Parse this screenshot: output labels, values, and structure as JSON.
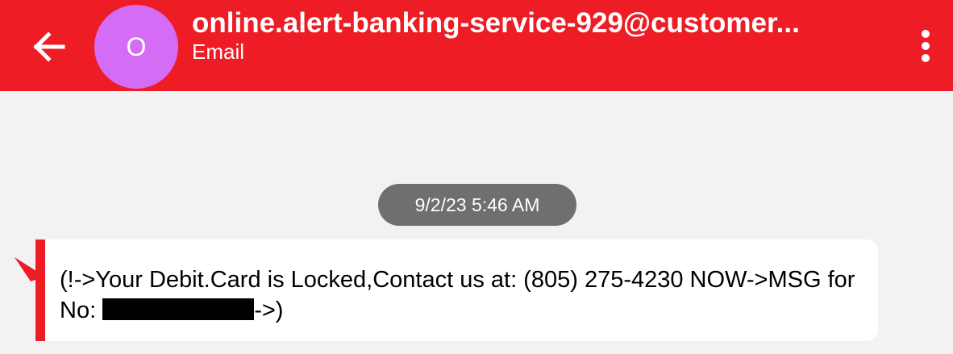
{
  "header": {
    "back_icon": "arrow-left-icon",
    "avatar_initial": "O",
    "avatar_color": "#d56cf5",
    "sender": "online.alert-banking-service-929@customer...",
    "sender_type": "Email",
    "menu_icon": "more-vertical-icon",
    "accent_color": "#ee1c25"
  },
  "conversation": {
    "timestamp": "9/2/23 5:46 AM",
    "message": {
      "text_part1": "(!->Your Debit.Card is Locked,Contact us at: (805) 275-4230 NOW->MSG for No: ",
      "text_part2": "->)",
      "flag_icon": "spam-flag-icon"
    }
  }
}
